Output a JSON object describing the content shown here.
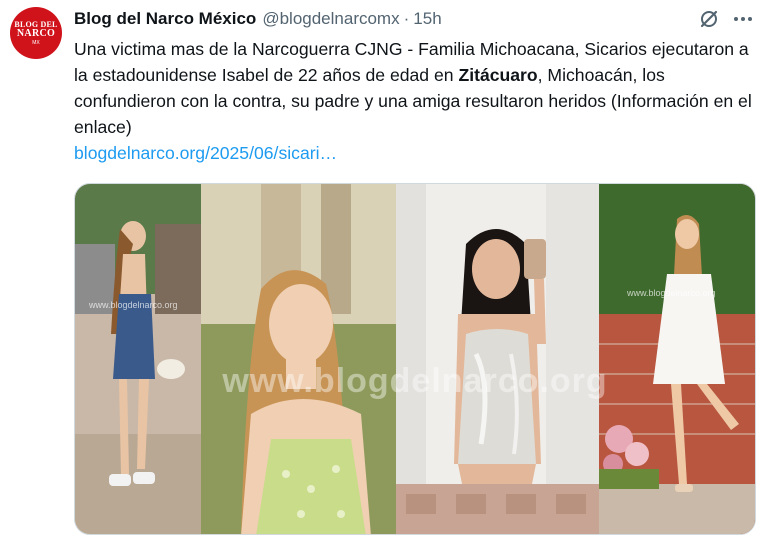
{
  "author": {
    "avatar_line1": "BLOG DEL",
    "avatar_line2": "NARCO",
    "avatar_line3": "MX",
    "name": "Blog del Narco México",
    "handle": "@blogdelnarcomx",
    "separator": "·",
    "time": "15h"
  },
  "tweet": {
    "text_before_bold": "Una victima mas de la Narcoguerra CJNG - Familia Michoacana, Sicarios ejecutaron a la estadounidense Isabel de 22 años de edad en ",
    "bold_text": "Zitácuaro",
    "text_after_bold": ", Michoacán, los confundieron con la contra, su padre y una amiga resultaron heridos (Información en el enlace)",
    "link": "blogdelnarco.org/2025/06/sicari…"
  },
  "media": {
    "watermark": "www.blogdelnarco.org",
    "watermark_small": "www.blogdelnarco.org",
    "photos": [
      {
        "name": "photo-1",
        "desc_icon": "image"
      },
      {
        "name": "photo-2",
        "desc_icon": "image"
      },
      {
        "name": "photo-3",
        "desc_icon": "image"
      },
      {
        "name": "photo-4",
        "desc_icon": "image"
      }
    ]
  },
  "icons": {
    "grok": "grok-icon",
    "more": "more-icon"
  },
  "colors": {
    "link": "#1d9bf0",
    "secondary_text": "#536471",
    "avatar_bg": "#d0121b"
  }
}
